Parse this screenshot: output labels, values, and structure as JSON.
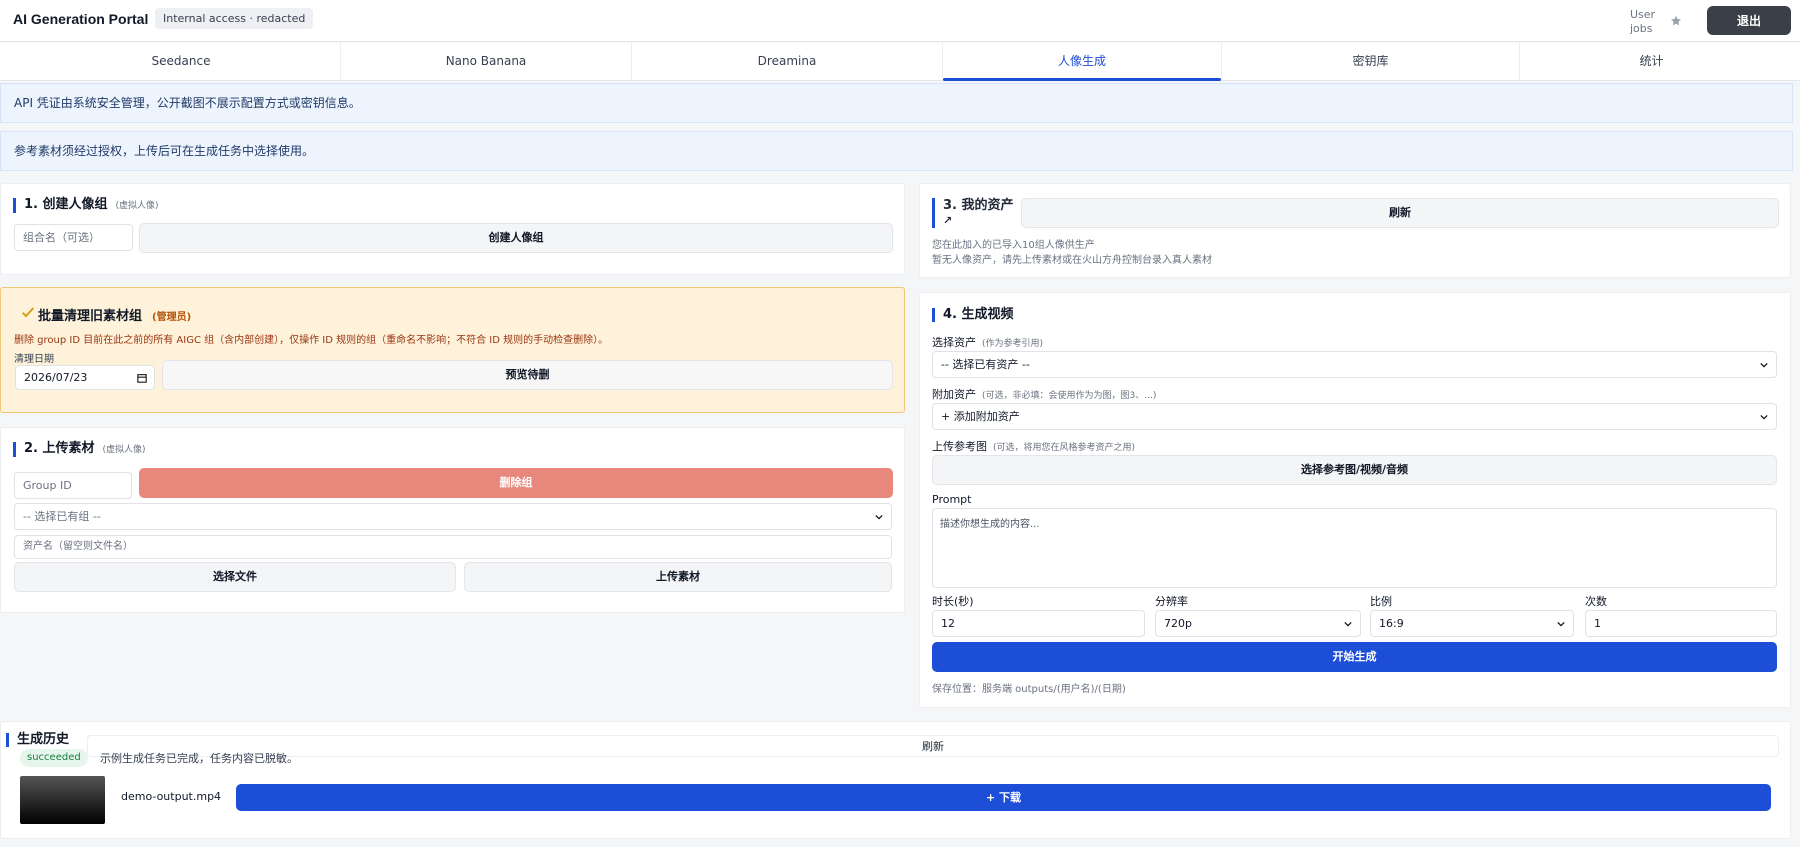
{
  "header": {
    "app_title": "AI Generation Portal",
    "access_badge": "Internal access · redacted",
    "user_label": "User jobs",
    "logout_label": "退出"
  },
  "tabs": [
    {
      "label": "Seedance",
      "active": false
    },
    {
      "label": "Nano Banana",
      "active": false
    },
    {
      "label": "Dreamina",
      "active": false
    },
    {
      "label": "人像生成",
      "active": true
    },
    {
      "label": "密钥库",
      "active": false
    },
    {
      "label": "统计",
      "active": false
    }
  ],
  "notices": {
    "credentials": "API 凭证由系统安全管理，公开截图不展示配置方式或密钥信息。",
    "authorization": "参考素材须经过授权，上传后可在生成任务中选择使用。"
  },
  "create_group": {
    "title": "1. 创建人像组",
    "subtitle": "(虚拟人像)",
    "name_placeholder": "组合名（可选）",
    "create_button": "创建人像组"
  },
  "cleanup": {
    "title": "批量清理旧素材组",
    "admin_tag": "(管理员)",
    "description": "删除 group ID 目前在此之前的所有 AIGC 组（含内部创建），仅操作 ID 规则的组（重命名不影响；不符合 ID 规则的手动检查删除）。",
    "date_label": "清理日期",
    "date_value": "2026/07/23",
    "preview_button": "预览待删"
  },
  "upload": {
    "title": "2. 上传素材",
    "subtitle": "(虚拟人像)",
    "group_id_placeholder": "Group ID",
    "delete_button": "删除组",
    "group_select": "-- 选择已有组 --",
    "asset_name_placeholder": "资产名（留空则文件名）",
    "choose_file_button": "选择文件",
    "upload_button": "上传素材"
  },
  "my_assets": {
    "title": "3. 我的资产",
    "title_arrow": "↗",
    "refresh_button": "刷新",
    "info_line1": "您在此加入的已导入10组人像供生产",
    "info_line2": "暂无人像资产，请先上传素材或在火山方舟控制台录入真人素材"
  },
  "generate": {
    "title": "4. 生成视频",
    "select_asset_label": "选择资产",
    "select_asset_hint": "(作为参考引用)",
    "select_asset_value": "-- 选择已有资产 --",
    "extra_asset_label": "附加资产",
    "extra_asset_hint": "(可选，非必填：会使用作为为图，图3、...)",
    "extra_asset_value": "+ 添加附加资产",
    "ref_label": "上传参考图",
    "ref_hint": "(可选，将用您在风格参考资产之用)",
    "ref_button": "选择参考图/视频/音频",
    "prompt_label": "Prompt",
    "prompt_placeholder": "描述你想生成的内容...",
    "duration_label": "时长(秒)",
    "duration_value": "12",
    "resolution_label": "分辨率",
    "resolution_value": "720p",
    "ratio_label": "比例",
    "ratio_value": "16:9",
    "count_label": "次数",
    "count_value": "1",
    "start_button": "开始生成",
    "save_location": "保存位置：服务端 outputs/(用户名)/(日期)"
  },
  "history": {
    "title": "生成历史",
    "refresh_button": "刷新",
    "status": "succeeded",
    "status_text": "示例生成任务已完成，任务内容已脱敏。",
    "filename": "demo-output.mp4",
    "download_button": "+ 下载"
  },
  "colors": {
    "accent": "#1d4ed8",
    "danger": "#e8877c",
    "warning_bg": "#fef3da",
    "success": "#15803d"
  }
}
